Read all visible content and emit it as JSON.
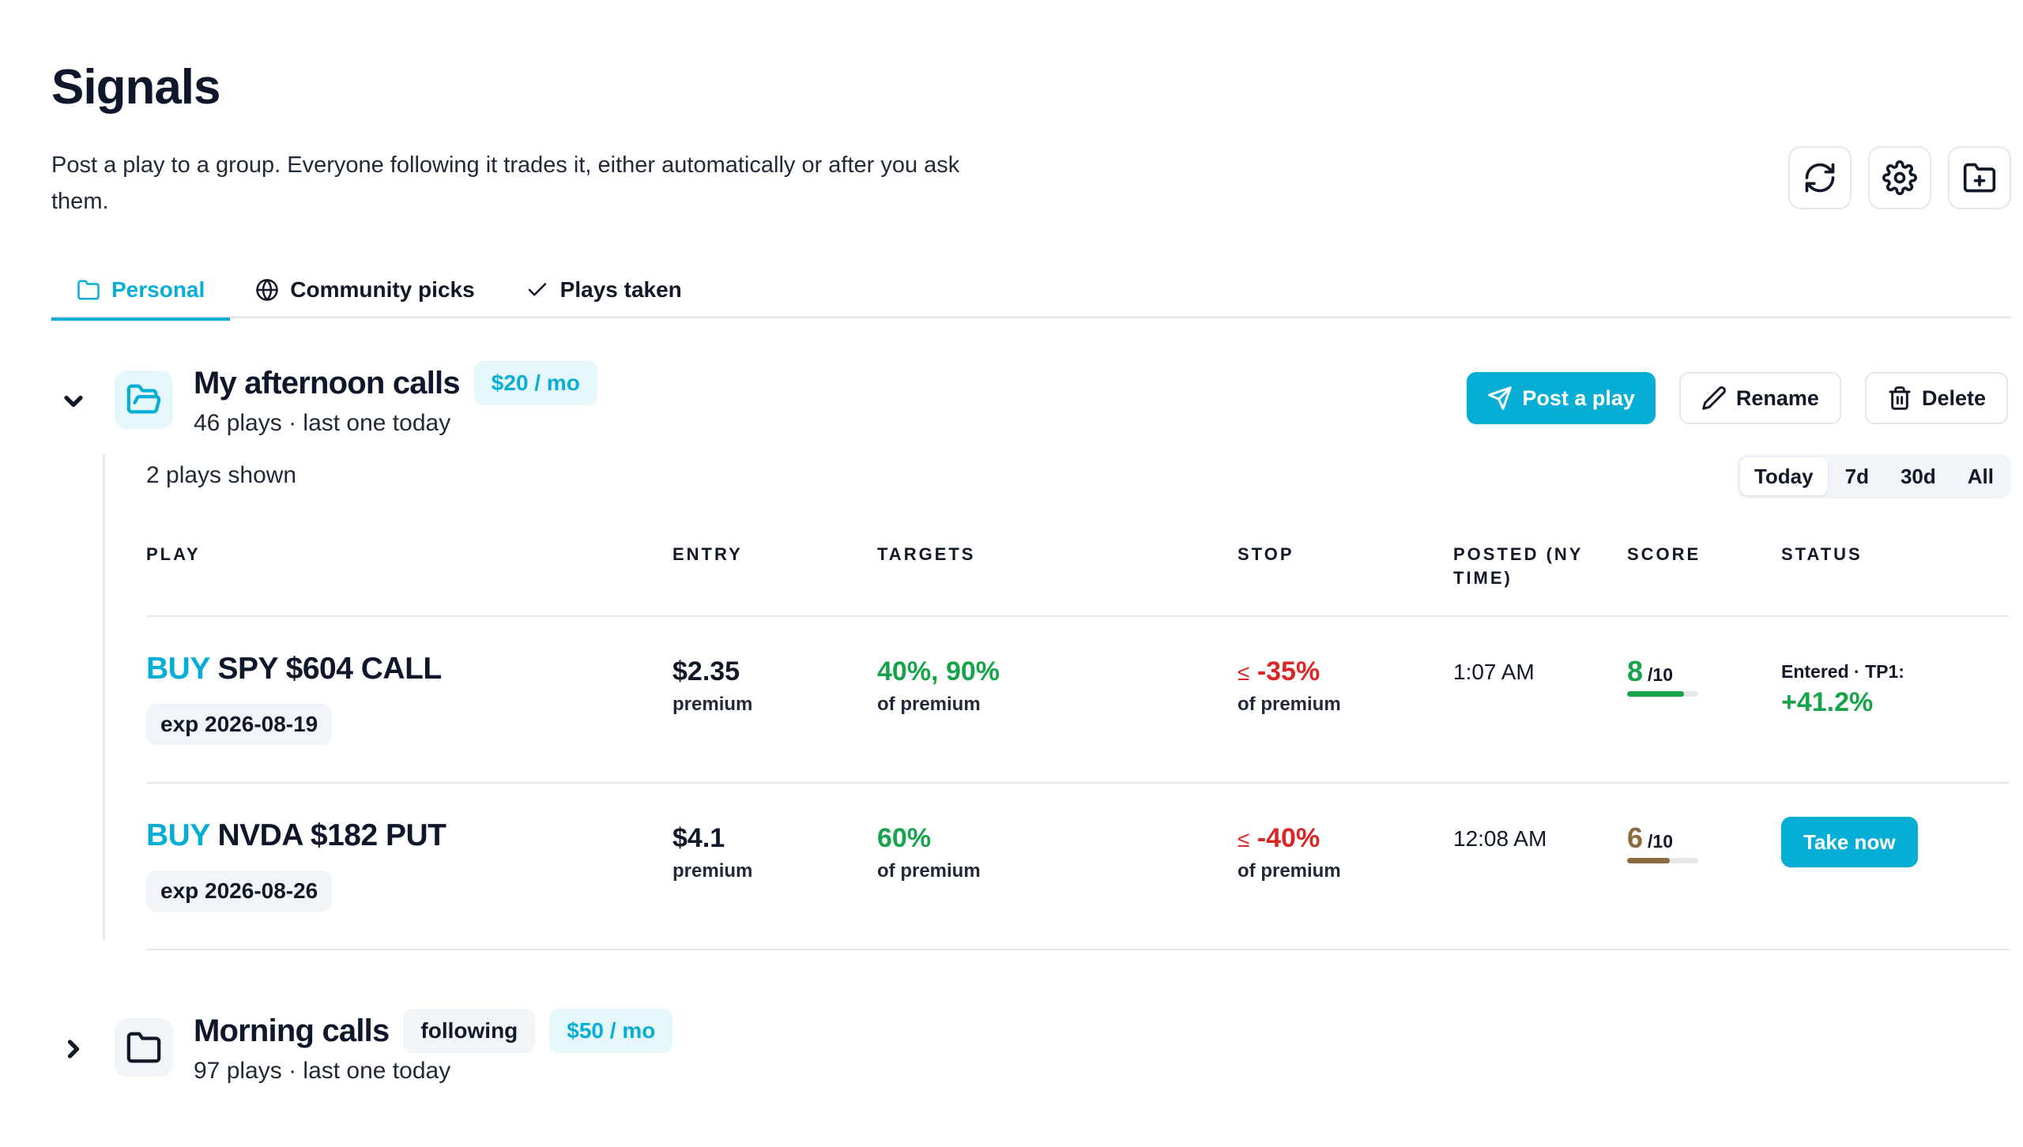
{
  "header": {
    "title": "Signals",
    "subtitle": "Post a play to a group. Everyone following it trades it, either automatically or after you ask them.",
    "actions": [
      {
        "name": "refresh-icon"
      },
      {
        "name": "gear-icon"
      },
      {
        "name": "folder-plus-icon"
      }
    ]
  },
  "tabs": [
    {
      "label": "Personal",
      "icon": "folder-icon",
      "active": true
    },
    {
      "label": "Community picks",
      "icon": "globe-icon",
      "active": false
    },
    {
      "label": "Plays taken",
      "icon": "check-icon",
      "active": false
    }
  ],
  "groups": [
    {
      "name": "My afternoon calls",
      "price": "$20 / mo",
      "meta": "46 plays · last one today",
      "expanded": true,
      "actions": {
        "post": "Post a play",
        "rename": "Rename",
        "delete": "Delete"
      },
      "shown": "2 plays shown",
      "ranges": [
        "Today",
        "7d",
        "30d",
        "All"
      ],
      "active_range": "Today",
      "columns": {
        "play": "PLAY",
        "entry": "ENTRY",
        "targets": "TARGETS",
        "stop": "STOP",
        "posted_1": "POSTED (NY",
        "posted_2": "TIME)",
        "score": "SCORE",
        "status": "STATUS"
      },
      "rows": [
        {
          "side": "BUY",
          "contract": "SPY $604 CALL",
          "exp": "exp 2026-08-19",
          "entry": "$2.35",
          "entry_unit": "premium",
          "targets": "40%, 90%",
          "targets_unit": "of premium",
          "stop_sym": "≤",
          "stop": "-35%",
          "stop_unit": "of premium",
          "posted": "1:07 AM",
          "score": "8",
          "score_of": "/10",
          "score_fraction": 0.8,
          "score_color": "#16a34a",
          "status_line": "Entered · TP1:",
          "status_value": "+41.2%"
        },
        {
          "side": "BUY",
          "contract": "NVDA $182 PUT",
          "exp": "exp 2026-08-26",
          "entry": "$4.1",
          "entry_unit": "premium",
          "targets": "60%",
          "targets_unit": "of premium",
          "stop_sym": "≤",
          "stop": "-40%",
          "stop_unit": "of premium",
          "posted": "12:08 AM",
          "score": "6",
          "score_of": "/10",
          "score_fraction": 0.6,
          "score_color": "#8b6a3e",
          "status_button": "Take now"
        }
      ]
    },
    {
      "name": "Morning calls",
      "badge": "following",
      "price": "$50 / mo",
      "meta": "97 plays · last one today",
      "expanded": false
    }
  ],
  "colors": {
    "accent": "#06aed5",
    "positive": "#16a34a",
    "negative": "#dc2626"
  }
}
